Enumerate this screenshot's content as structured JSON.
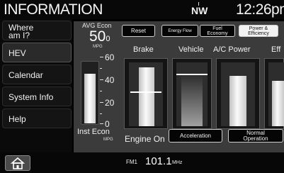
{
  "header": {
    "title": "INFORMATION",
    "compass": "NW",
    "time": "12:26pm"
  },
  "sidebar": {
    "items": [
      {
        "label_line1": "Where",
        "label_line2": "am I?"
      },
      {
        "label": "HEV"
      },
      {
        "label": "Calendar"
      },
      {
        "label": "System Info"
      },
      {
        "label": "Help"
      }
    ]
  },
  "avg_econ": {
    "label": "AVG Econ",
    "value": "50",
    "value_sub": "0",
    "unit": "MPG"
  },
  "tabs": {
    "reset": "Reset",
    "energy_flow": "Energy Flow",
    "fuel_economy_1": "Fuel",
    "fuel_economy_2": "Economy",
    "power_efficiency_1": "Power &",
    "power_efficiency_2": "Efficiency"
  },
  "columns": {
    "brake": "Brake",
    "vehicle": "Vehicle",
    "ac_power": "A/C Power",
    "eff": "Eff"
  },
  "gauge": {
    "ticks": [
      "60",
      "40",
      "20",
      "0"
    ],
    "level_fraction": 0.78
  },
  "inst_econ": {
    "label": "Inst Econ",
    "unit": "MPG"
  },
  "engine": {
    "status": "Engine On",
    "acceleration": "Acceleration",
    "normal_1": "Normal",
    "normal_2": "Operation"
  },
  "bottom": {
    "band": "FM1",
    "frequency": "101.1",
    "unit": "MHz"
  },
  "colors": {
    "panel": "#3b3b3b",
    "accent": "#ffffff",
    "background": "#000000"
  }
}
